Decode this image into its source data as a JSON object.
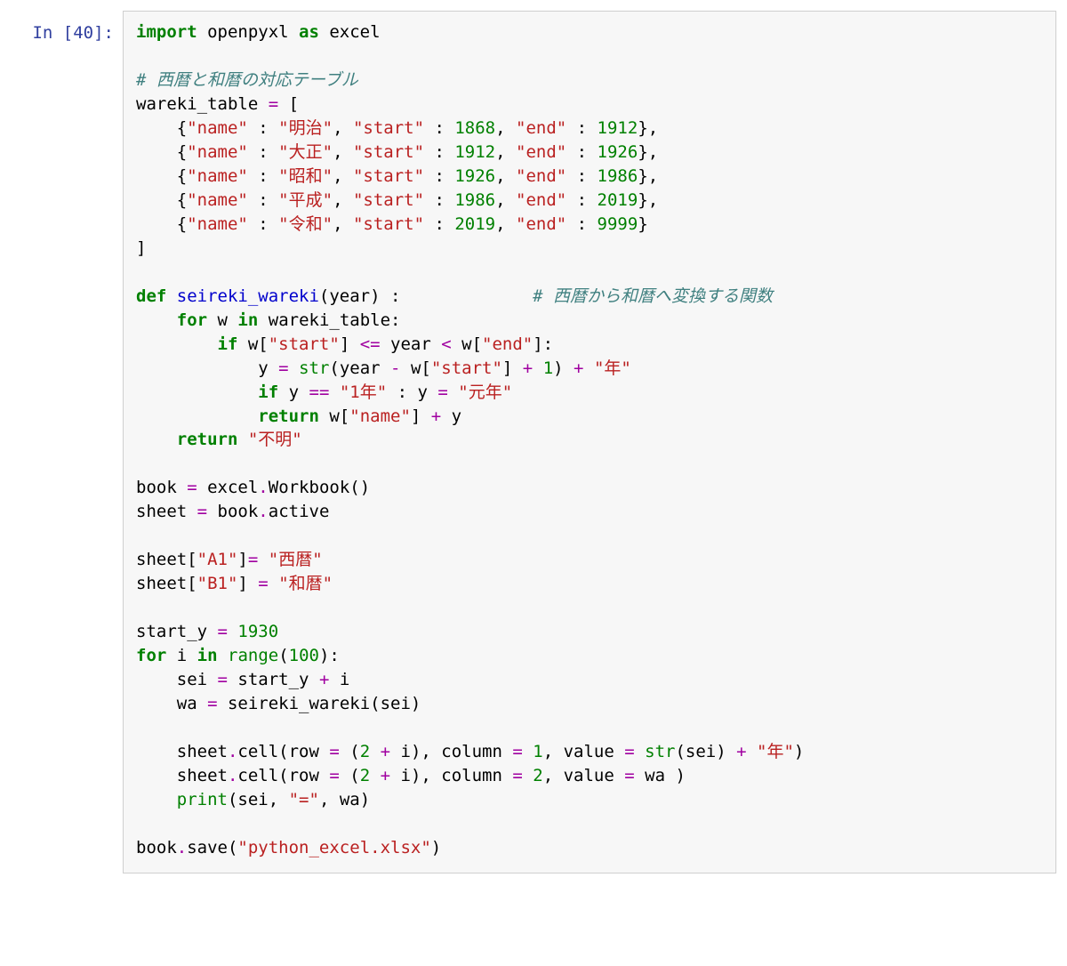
{
  "prompt": {
    "label": "In [40]:"
  },
  "code": {
    "l01_kw_import": "import",
    "l01_mod": " openpyxl ",
    "l01_kw_as": "as",
    "l01_alias": " excel",
    "l03_cm": "# 西暦と和暦の対応テーブル",
    "l04_a": "wareki_table ",
    "l04_op": "=",
    "l04_b": " [",
    "row": {
      "open": "    {",
      "k_name": "\"name\"",
      "col": " : ",
      "k_start": "\"start\"",
      "k_end": "\"end\"",
      "sep": ", ",
      "close": "},",
      "close_last": "}"
    },
    "eras": [
      {
        "name": "\"明治\"",
        "start": "1868",
        "end": "1912"
      },
      {
        "name": "\"大正\"",
        "start": "1912",
        "end": "1926"
      },
      {
        "name": "\"昭和\"",
        "start": "1926",
        "end": "1986"
      },
      {
        "name": "\"平成\"",
        "start": "1986",
        "end": "2019"
      },
      {
        "name": "\"令和\"",
        "start": "2019",
        "end": "9999"
      }
    ],
    "l10_close": "]",
    "l12_kw_def": "def",
    "l12_name": " seireki_wareki",
    "l12_sig": "(year) :",
    "l12_cm": "             # 西暦から和暦へ変換する関数",
    "l13_ind": "    ",
    "l13_kw_for": "for",
    "l13_a": " w ",
    "l13_kw_in": "in",
    "l13_b": " wareki_table:",
    "l14_ind": "        ",
    "l14_kw_if": "if",
    "l14_a": " w[",
    "l14_s1": "\"start\"",
    "l14_b": "] ",
    "l14_op1": "<=",
    "l14_c": " year ",
    "l14_op2": "<",
    "l14_d": " w[",
    "l14_s2": "\"end\"",
    "l14_e": "]:",
    "l15_ind": "            ",
    "l15_a": "y ",
    "l15_op1": "=",
    "l15_b": " ",
    "l15_bi": "str",
    "l15_c": "(year ",
    "l15_op2": "-",
    "l15_d": " w[",
    "l15_s": "\"start\"",
    "l15_e": "] ",
    "l15_op3": "+",
    "l15_f": " ",
    "l15_n": "1",
    "l15_g": ") ",
    "l15_op4": "+",
    "l15_h": " ",
    "l15_str": "\"年\"",
    "l16_ind": "            ",
    "l16_kw_if": "if",
    "l16_a": " y ",
    "l16_op1": "==",
    "l16_b": " ",
    "l16_s1": "\"1年\"",
    "l16_c": " : y ",
    "l16_op2": "=",
    "l16_d": " ",
    "l16_s2": "\"元年\"",
    "l17_ind": "            ",
    "l17_kw": "return",
    "l17_a": " w[",
    "l17_s": "\"name\"",
    "l17_b": "] ",
    "l17_op": "+",
    "l17_c": " y",
    "l18_ind": "    ",
    "l18_kw": "return",
    "l18_sp": " ",
    "l18_s": "\"不明\"",
    "l20_a": "book ",
    "l20_op": "=",
    "l20_b": " excel",
    "l20_op2": ".",
    "l20_c": "Workbook()",
    "l21_a": "sheet ",
    "l21_op": "=",
    "l21_b": " book",
    "l21_op2": ".",
    "l21_c": "active",
    "l23_a": "sheet[",
    "l23_s1": "\"A1\"",
    "l23_b": "]",
    "l23_op": "=",
    "l23_c": " ",
    "l23_s2": "\"西暦\"",
    "l24_a": "sheet[",
    "l24_s1": "\"B1\"",
    "l24_b": "] ",
    "l24_op": "=",
    "l24_c": " ",
    "l24_s2": "\"和暦\"",
    "l26_a": "start_y ",
    "l26_op": "=",
    "l26_b": " ",
    "l26_n": "1930",
    "l27_kw_for": "for",
    "l27_a": " i ",
    "l27_kw_in": "in",
    "l27_b": " ",
    "l27_bi": "range",
    "l27_c": "(",
    "l27_n": "100",
    "l27_d": "):",
    "l28_ind": "    ",
    "l28_a": "sei ",
    "l28_op1": "=",
    "l28_b": " start_y ",
    "l28_op2": "+",
    "l28_c": " i",
    "l29_ind": "    ",
    "l29_a": "wa ",
    "l29_op": "=",
    "l29_b": " seireki_wareki(sei)",
    "l31_ind": "    ",
    "l31_a": "sheet",
    "l31_dot": ".",
    "l31_b": "cell(row ",
    "l31_op1": "=",
    "l31_c": " (",
    "l31_n1": "2",
    "l31_d": " ",
    "l31_op2": "+",
    "l31_e": " i), column ",
    "l31_op3": "=",
    "l31_f": " ",
    "l31_n2": "1",
    "l31_g": ", value ",
    "l31_op4": "=",
    "l31_h": " ",
    "l31_bi": "str",
    "l31_i": "(sei) ",
    "l31_op5": "+",
    "l31_j": " ",
    "l31_s": "\"年\"",
    "l31_k": ")",
    "l32_ind": "    ",
    "l32_a": "sheet",
    "l32_dot": ".",
    "l32_b": "cell(row ",
    "l32_op1": "=",
    "l32_c": " (",
    "l32_n1": "2",
    "l32_d": " ",
    "l32_op2": "+",
    "l32_e": " i), column ",
    "l32_op3": "=",
    "l32_f": " ",
    "l32_n2": "2",
    "l32_g": ", value ",
    "l32_op4": "=",
    "l32_h": " wa )",
    "l33_ind": "    ",
    "l33_bi": "print",
    "l33_a": "(sei, ",
    "l33_s": "\"=\"",
    "l33_b": ", wa)",
    "l35_a": "book",
    "l35_dot": ".",
    "l35_b": "save(",
    "l35_s": "\"python_excel.xlsx\"",
    "l35_c": ")"
  }
}
